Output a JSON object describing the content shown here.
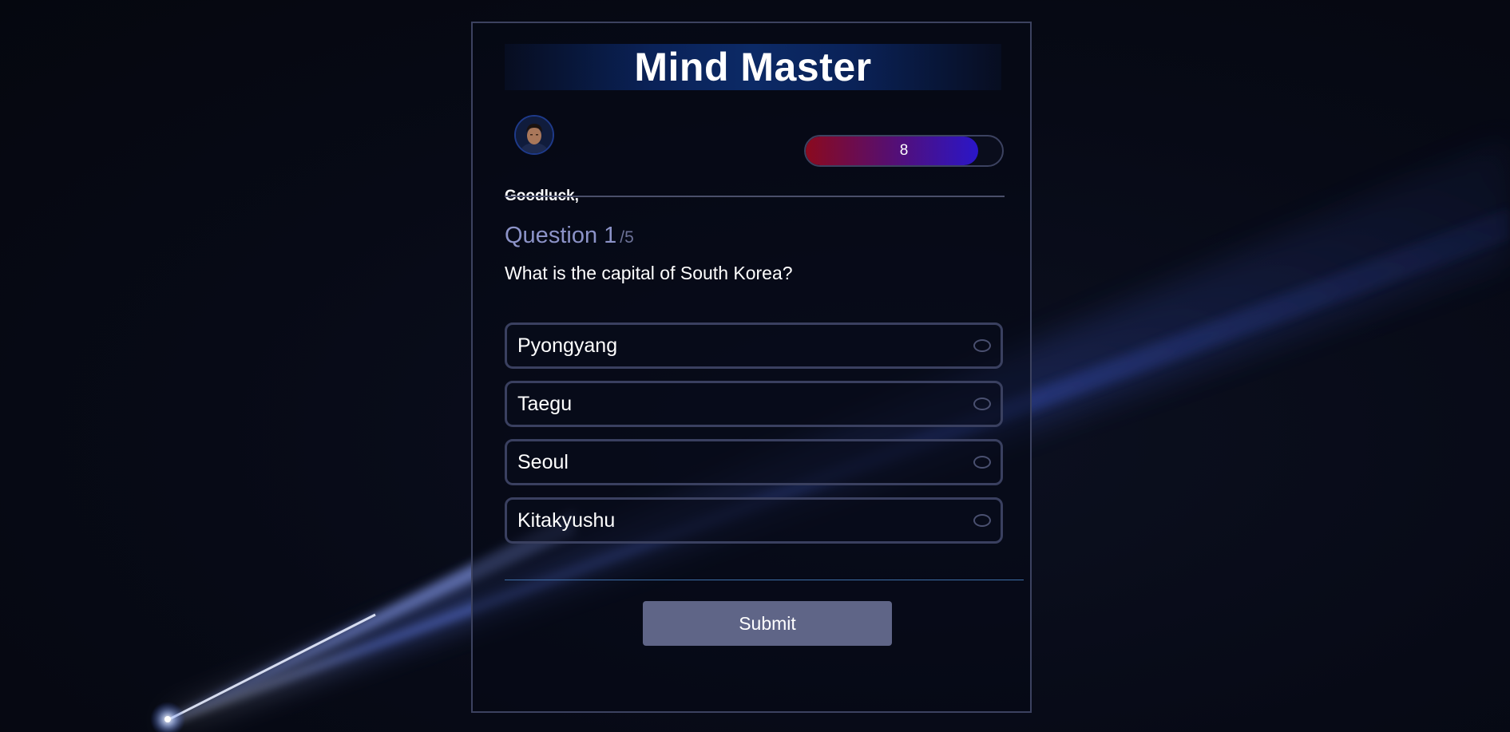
{
  "app": {
    "title": "Mind Master"
  },
  "user": {
    "greeting": "Goodluck,"
  },
  "score": {
    "value": "8",
    "fill_fraction": 0.88
  },
  "question": {
    "label": "Question 1",
    "total": "/5",
    "text": "What is the capital of South Korea?"
  },
  "options": [
    {
      "label": "Pyongyang"
    },
    {
      "label": "Taegu"
    },
    {
      "label": "Seoul"
    },
    {
      "label": "Kitakyushu"
    }
  ],
  "actions": {
    "submit_label": "Submit"
  },
  "colors": {
    "score_gradient_start": "#8b0a1e",
    "score_gradient_end": "#2a16c8",
    "submit_bg": "#5f6587",
    "question_num": "#8c93c8"
  }
}
